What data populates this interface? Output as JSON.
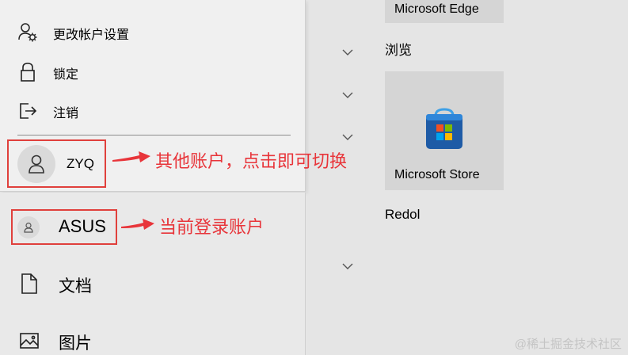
{
  "account_menu": {
    "items": [
      {
        "label": "更改帐户设置",
        "icon": "person-gear-icon"
      },
      {
        "label": "锁定",
        "icon": "lock-icon"
      },
      {
        "label": "注销",
        "icon": "sign-out-icon"
      }
    ],
    "other_account": {
      "name": "ZYQ",
      "icon": "person-icon"
    },
    "current_account": {
      "name": "ASUS",
      "icon": "person-icon"
    }
  },
  "nav": {
    "items": [
      {
        "label": "文档",
        "icon": "document-icon"
      },
      {
        "label": "图片",
        "icon": "picture-icon"
      }
    ]
  },
  "annotations": {
    "other_account_note": "其他账户，点击即可切换",
    "current_account_note": "当前登录账户",
    "color": "#e8353a"
  },
  "start": {
    "tiles": [
      {
        "label": "Microsoft Edge"
      },
      {
        "label": "Microsoft Store",
        "icon": "microsoft-store-icon"
      }
    ],
    "groups": [
      "浏览",
      "Redol"
    ]
  },
  "watermark": "@稀土掘金技术社区"
}
